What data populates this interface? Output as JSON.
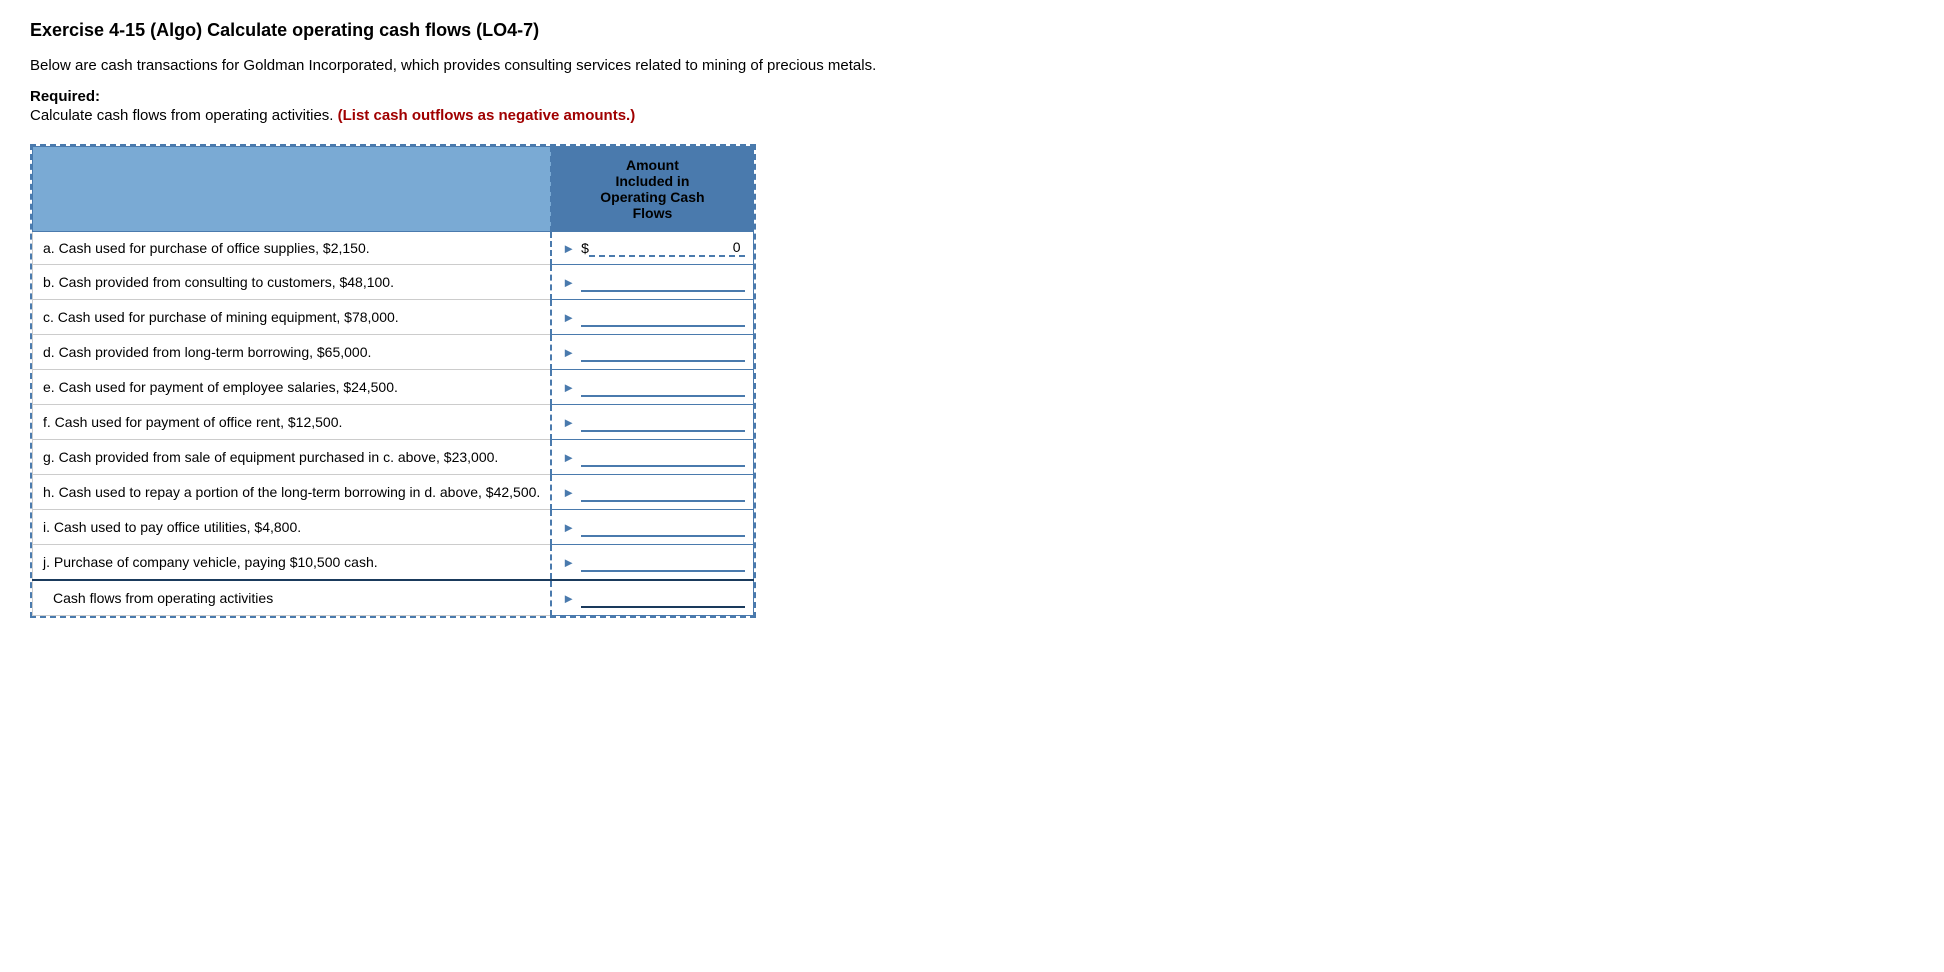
{
  "page": {
    "title": "Exercise 4-15 (Algo) Calculate operating cash flows (LO4-7)",
    "intro": "Below are cash transactions for Goldman Incorporated, which provides consulting services related to mining of precious metals.",
    "required_label": "Required:",
    "instructions_plain": "Calculate cash flows from operating activities.",
    "instructions_red": "(List cash outflows as negative amounts.)"
  },
  "table": {
    "header_description": "",
    "header_amount_line1": "Amount",
    "header_amount_line2": "Included in",
    "header_amount_line3": "Operating Cash",
    "header_amount_line4": "Flows",
    "rows": [
      {
        "label": "a. Cash used for purchase of office supplies, $2,150.",
        "dollar": "$",
        "value": "0",
        "show_dollar": true
      },
      {
        "label": "b. Cash provided from consulting to customers, $48,100.",
        "dollar": "",
        "value": "",
        "show_dollar": false
      },
      {
        "label": "c. Cash used for purchase of mining equipment, $78,000.",
        "dollar": "",
        "value": "",
        "show_dollar": false
      },
      {
        "label": "d. Cash provided from long-term borrowing, $65,000.",
        "dollar": "",
        "value": "",
        "show_dollar": false
      },
      {
        "label": "e. Cash used for payment of employee salaries, $24,500.",
        "dollar": "",
        "value": "",
        "show_dollar": false
      },
      {
        "label": "f. Cash used for payment of office rent, $12,500.",
        "dollar": "",
        "value": "",
        "show_dollar": false
      },
      {
        "label": "g. Cash provided from sale of equipment purchased in c. above, $23,000.",
        "dollar": "",
        "value": "",
        "show_dollar": false
      },
      {
        "label": "h. Cash used to repay a portion of the long-term borrowing in d. above, $42,500.",
        "dollar": "",
        "value": "",
        "show_dollar": false
      },
      {
        "label": "i. Cash used to pay office utilities, $4,800.",
        "dollar": "",
        "value": "",
        "show_dollar": false
      },
      {
        "label": "j.   Purchase of company vehicle, paying $10,500 cash.",
        "dollar": "",
        "value": "",
        "show_dollar": false
      }
    ],
    "total_row_label": "Cash flows from operating activities"
  }
}
